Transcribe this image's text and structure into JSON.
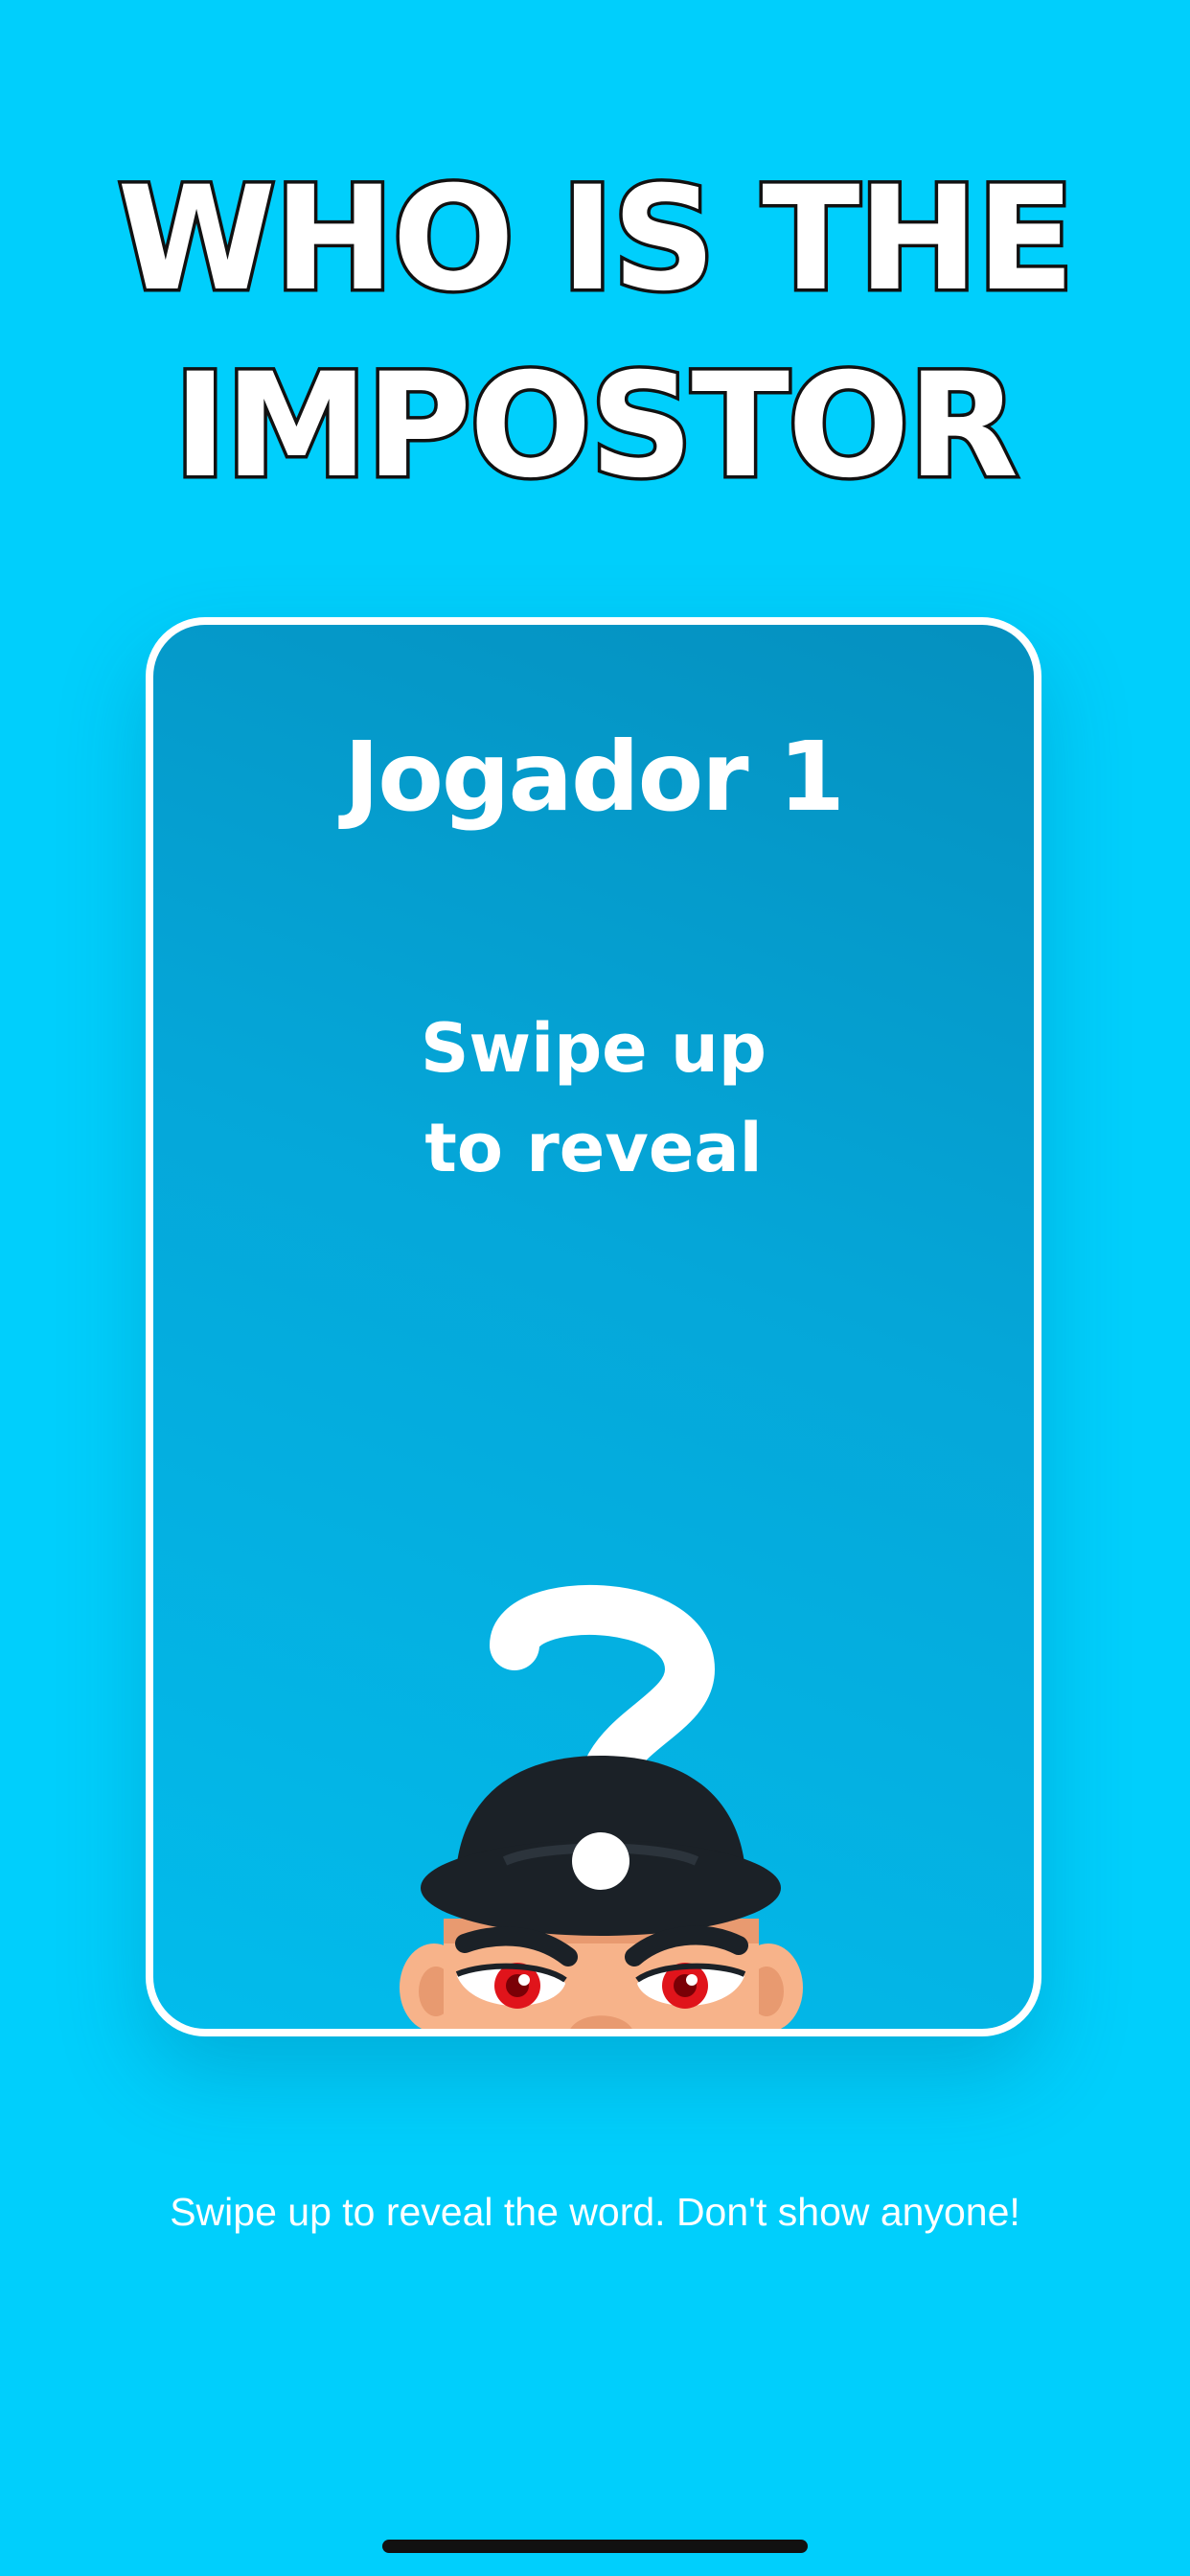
{
  "app": {
    "title_line_1": "WHO IS THE",
    "title_line_2": "IMPOSTOR"
  },
  "card": {
    "player_name": "Jogador 1",
    "reveal_prompt": "Swipe up\nto reveal",
    "illustration": "question-mark-impostor-character-icon"
  },
  "footer": {
    "hint": "Swipe up to reveal the word. Don't show anyone!"
  },
  "colors": {
    "background": "#00CFFC",
    "card_gradient_top": "#0590BF",
    "card_gradient_bottom": "#02BCEC",
    "card_border": "#FFFFFF",
    "title_stroke": "#111111",
    "hat": "#1B2127",
    "skin": "#F7B38A",
    "eye_red": "#E0141B"
  }
}
